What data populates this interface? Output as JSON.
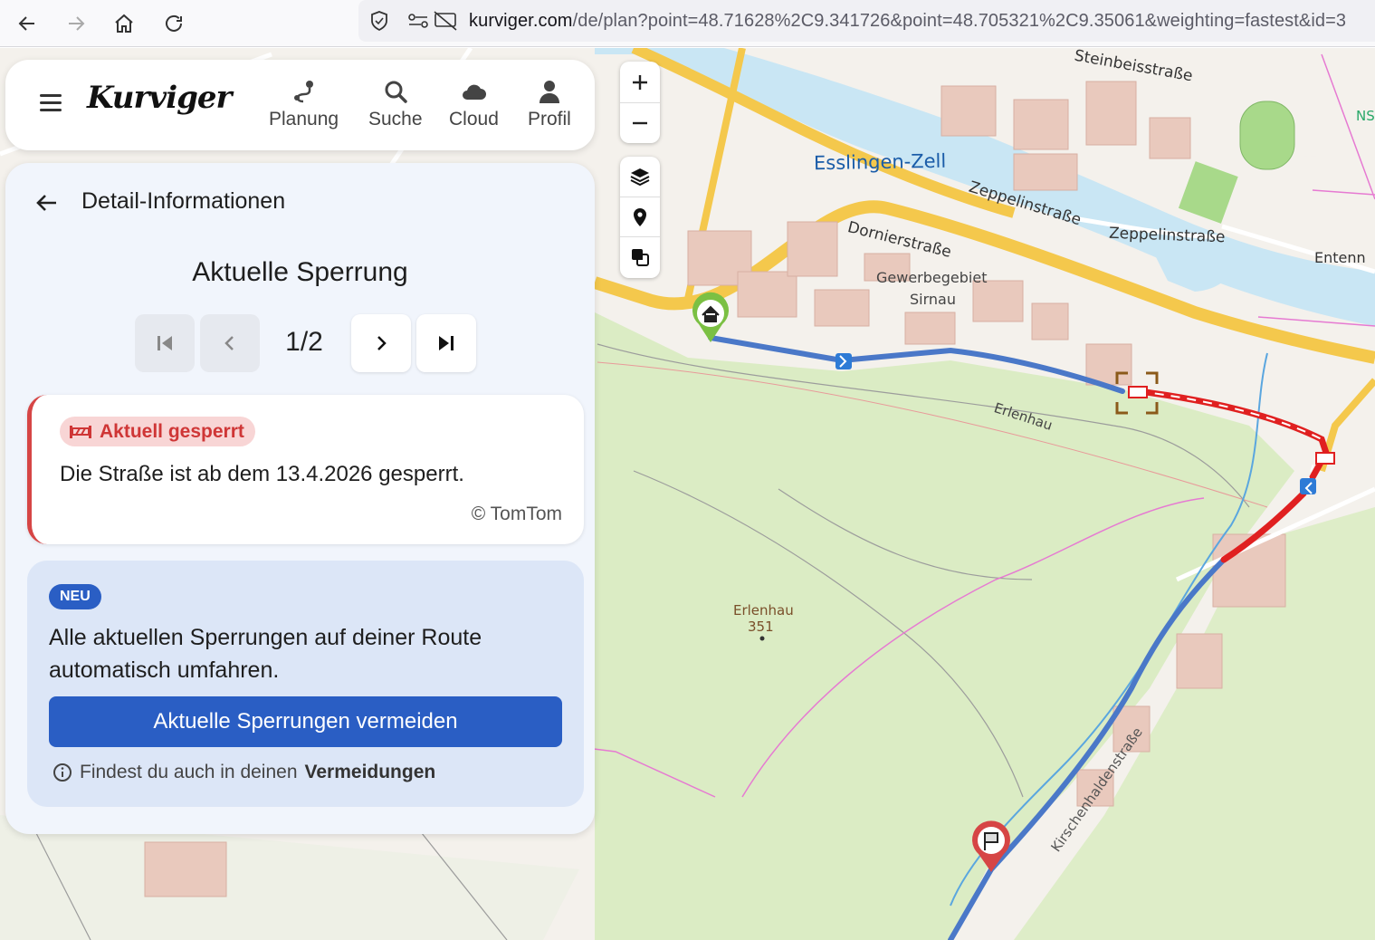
{
  "browser": {
    "url_host": "kurviger.com",
    "url_path": "/de/plan?point=48.71628%2C9.341726&point=48.705321%2C9.35061&weighting=fastest&id=3"
  },
  "app": {
    "logo": "Kurviger",
    "nav": [
      {
        "label": "Planung",
        "icon": "route-icon"
      },
      {
        "label": "Suche",
        "icon": "search-icon"
      },
      {
        "label": "Cloud",
        "icon": "cloud-icon"
      },
      {
        "label": "Profil",
        "icon": "user-icon"
      }
    ]
  },
  "detail": {
    "title": "Detail-Informationen",
    "section_title": "Aktuelle Sperrung",
    "pager": {
      "current": 1,
      "total": 2,
      "label": "1/2"
    },
    "alert": {
      "badge": "Aktuell gesperrt",
      "text": "Die Straße ist ab dem 13.4.2026 gesperrt.",
      "source": "© TomTom",
      "color": "#d64545"
    },
    "promo": {
      "badge": "NEU",
      "text": "Alle aktuellen Sperrungen auf deiner Route automatisch umfahren.",
      "button": "Aktuelle Sperrungen vermeiden",
      "note_prefix": "Findest du auch in deinen",
      "note_link": "Vermeidungen",
      "accent": "#2a5ec4"
    }
  },
  "map": {
    "labels": {
      "district": "Esslingen-Zell",
      "street_zeppelin_1": "Zeppelinstraße",
      "street_zeppelin_2": "Zeppelinstraße",
      "street_dornier": "Dornierstraße",
      "street_steinbeis": "Steinbeisstraße",
      "area_line1": "Gewerbegebiet",
      "area_line2": "Sirnau",
      "street_erlenhau": "Erlenhau",
      "peak_name": "Erlenhau",
      "peak_elev": "351",
      "street_entenn": "Entenn",
      "ns": "NS",
      "street_kirschenhaldenstrasse": "Kirschenhaldenstraße"
    },
    "route_color": "#4a78c8",
    "closure_color": "#e02020"
  }
}
